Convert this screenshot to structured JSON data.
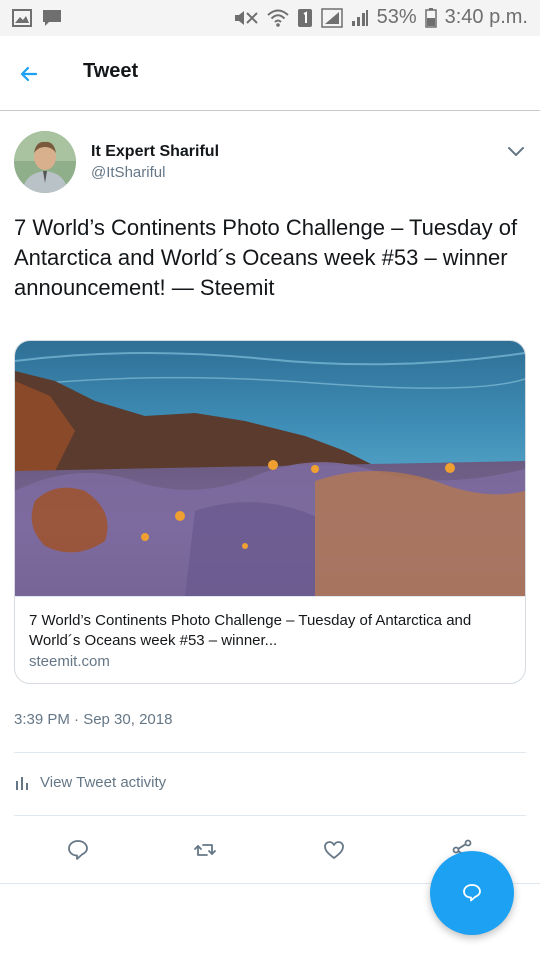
{
  "status_bar": {
    "battery": "53%",
    "time": "3:40 p.m."
  },
  "header": {
    "title": "Tweet"
  },
  "tweet": {
    "author_name": "It Expert Shariful",
    "author_handle": "@ItShariful",
    "text": "7 World’s Continents Photo Challenge – Tuesday of Antarctica and World´s Oceans week #53 – winner announcement! — Steemit",
    "timestamp": "3:39 PM · Sep 30, 2018"
  },
  "link_card": {
    "title": "7 World’s Continents Photo Challenge – Tuesday of Antarctica and World´s Oceans week #53 – winner...",
    "domain": "steemit.com"
  },
  "activity": {
    "label": "View Tweet activity"
  },
  "icons": {
    "back": "arrow-left-icon",
    "menu": "chevron-down-icon",
    "reply": "reply-icon",
    "retweet": "retweet-icon",
    "like": "heart-icon",
    "share": "share-icon",
    "compose": "compose-icon",
    "activity": "bar-chart-icon"
  },
  "colors": {
    "accent": "#1da1f2",
    "secondary_text": "#657786",
    "divider": "#e1e8ed"
  }
}
